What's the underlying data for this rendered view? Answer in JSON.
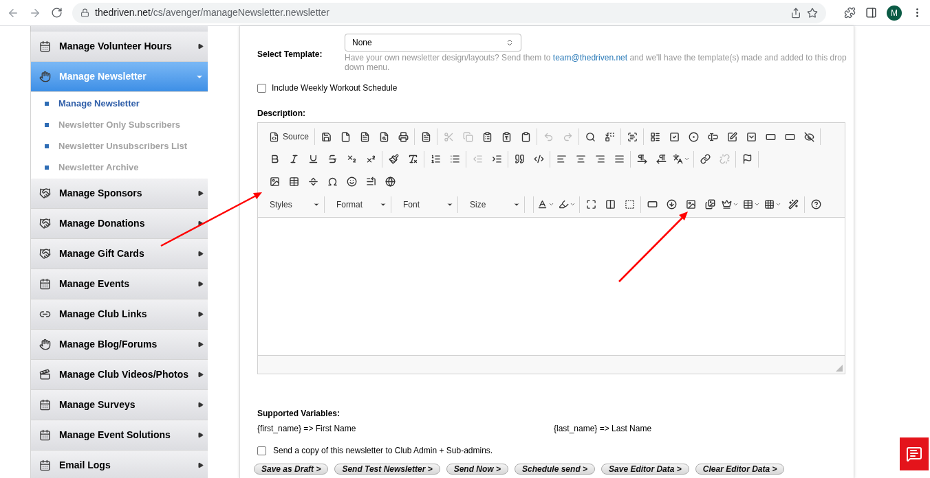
{
  "browser": {
    "url_domain": "thedriven.net",
    "url_path": "/cs/avenger/manageNewsletter.newsletter",
    "avatar": "M"
  },
  "sidebar": {
    "items": [
      {
        "label": "Manage Volunteer Hours",
        "selected": false,
        "expanded": false
      },
      {
        "label": "Manage Newsletter",
        "selected": true,
        "expanded": true,
        "children": [
          {
            "label": "Manage Newsletter",
            "selected": true
          },
          {
            "label": "Newsletter Only Subscribers",
            "selected": false
          },
          {
            "label": "Newsletter Unsubscribers List",
            "selected": false
          },
          {
            "label": "Newsletter Archive",
            "selected": false
          }
        ]
      },
      {
        "label": "Manage Sponsors",
        "selected": false,
        "expanded": false
      },
      {
        "label": "Manage Donations",
        "selected": false,
        "expanded": false
      },
      {
        "label": "Manage Gift Cards",
        "selected": false,
        "expanded": false
      },
      {
        "label": "Manage Events",
        "selected": false,
        "expanded": false
      },
      {
        "label": "Manage Club Links",
        "selected": false,
        "expanded": false
      },
      {
        "label": "Manage Blog/Forums",
        "selected": false,
        "expanded": false
      },
      {
        "label": "Manage Club Videos/Photos",
        "selected": false,
        "expanded": false
      },
      {
        "label": "Manage Surveys",
        "selected": false,
        "expanded": false
      },
      {
        "label": "Manage Event Solutions",
        "selected": false,
        "expanded": false
      },
      {
        "label": "Email Logs",
        "selected": false,
        "expanded": false
      }
    ]
  },
  "form": {
    "template_label": "Select Template:",
    "template_value": "None",
    "template_hint_before": "Have your own newsletter design/layouts? Send them to ",
    "template_hint_link": "team@thedriven.net",
    "template_hint_after": " and we'll have the template(s) made and added to this drop down menu.",
    "weekly_workout": {
      "label": "Include Weekly Workout Schedule",
      "checked": false
    },
    "description_label": "Description:",
    "toolbar": [
      [
        [
          {
            "kind": "labeled",
            "label": "Source",
            "disabled": false
          }
        ],
        [
          {
            "kind": "icon",
            "disabled": false
          },
          {
            "kind": "icon",
            "disabled": false
          },
          {
            "kind": "icon",
            "disabled": false
          },
          {
            "kind": "icon",
            "disabled": false
          },
          {
            "kind": "icon",
            "disabled": false
          }
        ],
        [
          {
            "kind": "icon",
            "disabled": false
          }
        ],
        [
          {
            "kind": "icon",
            "disabled": true
          },
          {
            "kind": "icon",
            "disabled": true
          },
          {
            "kind": "icon",
            "disabled": false
          },
          {
            "kind": "icon",
            "disabled": false
          },
          {
            "kind": "icon",
            "disabled": false
          }
        ],
        [
          {
            "kind": "icon",
            "disabled": true
          },
          {
            "kind": "icon",
            "disabled": true
          }
        ],
        [
          {
            "kind": "icon",
            "disabled": false
          },
          {
            "kind": "icon",
            "disabled": false
          }
        ],
        [
          {
            "kind": "icon",
            "disabled": false
          }
        ],
        [
          {
            "kind": "icon",
            "disabled": false
          },
          {
            "kind": "icon",
            "disabled": false
          },
          {
            "kind": "icon",
            "disabled": false
          },
          {
            "kind": "icon",
            "disabled": false
          },
          {
            "kind": "icon",
            "disabled": false
          },
          {
            "kind": "icon",
            "disabled": false
          },
          {
            "kind": "icon",
            "disabled": false
          },
          {
            "kind": "icon",
            "disabled": false
          },
          {
            "kind": "icon",
            "disabled": false
          }
        ]
      ],
      [
        [
          {
            "kind": "icon",
            "disabled": false
          },
          {
            "kind": "icon",
            "disabled": false
          },
          {
            "kind": "icon",
            "disabled": false
          },
          {
            "kind": "icon",
            "disabled": false
          },
          {
            "kind": "icon",
            "disabled": false
          },
          {
            "kind": "icon",
            "disabled": false
          }
        ],
        [
          {
            "kind": "icon",
            "disabled": false
          },
          {
            "kind": "icon",
            "disabled": false
          }
        ],
        [
          {
            "kind": "icon",
            "disabled": false
          },
          {
            "kind": "icon",
            "disabled": false
          }
        ],
        [
          {
            "kind": "icon",
            "disabled": true
          },
          {
            "kind": "icon",
            "disabled": false
          }
        ],
        [
          {
            "kind": "icon",
            "disabled": false
          },
          {
            "kind": "icon",
            "disabled": false
          }
        ],
        [
          {
            "kind": "icon",
            "disabled": false
          },
          {
            "kind": "icon",
            "disabled": false
          },
          {
            "kind": "icon",
            "disabled": false
          },
          {
            "kind": "icon",
            "disabled": false
          }
        ],
        [
          {
            "kind": "icon",
            "disabled": false
          },
          {
            "kind": "icon",
            "disabled": false
          },
          {
            "kind": "icon",
            "disabled": false
          }
        ],
        [
          {
            "kind": "icon",
            "disabled": false
          },
          {
            "kind": "icon",
            "disabled": true
          }
        ],
        [
          {
            "kind": "icon",
            "disabled": false
          }
        ]
      ],
      [
        [
          {
            "kind": "icon",
            "disabled": false
          },
          {
            "kind": "icon",
            "disabled": false
          },
          {
            "kind": "icon",
            "disabled": false
          },
          {
            "kind": "icon",
            "disabled": false
          },
          {
            "kind": "icon",
            "disabled": false
          },
          {
            "kind": "icon",
            "disabled": false
          },
          {
            "kind": "icon",
            "disabled": false
          }
        ]
      ],
      [
        [
          {
            "kind": "combo",
            "label": "Styles",
            "disabled": false
          },
          {
            "kind": "combo",
            "label": "Format",
            "disabled": false
          },
          {
            "kind": "combo",
            "label": "Font",
            "disabled": false
          },
          {
            "kind": "combo",
            "label": "Size",
            "disabled": false
          }
        ],
        [
          {
            "kind": "icon",
            "disabled": false
          },
          {
            "kind": "icon",
            "disabled": false
          }
        ],
        [
          {
            "kind": "icon",
            "disabled": false
          },
          {
            "kind": "icon",
            "disabled": false
          },
          {
            "kind": "icon",
            "disabled": false
          }
        ],
        [
          {
            "kind": "icon",
            "disabled": false
          },
          {
            "kind": "icon",
            "disabled": false
          },
          {
            "kind": "icon",
            "disabled": false
          },
          {
            "kind": "icon",
            "disabled": false
          },
          {
            "kind": "icon",
            "disabled": false
          },
          {
            "kind": "icon",
            "disabled": false
          },
          {
            "kind": "icon",
            "disabled": false
          },
          {
            "kind": "icon",
            "disabled": false
          }
        ],
        [
          {
            "kind": "icon",
            "disabled": false
          }
        ]
      ]
    ],
    "variables_title": "Supported Variables:",
    "variables": [
      "{first_name} => First Name",
      "{last_name} => Last Name"
    ],
    "send_copy": {
      "label": "Send a copy of this newsletter to Club Admin + Sub-admins.",
      "checked": false
    },
    "buttons": [
      "Save as Draft >",
      "Send Test Newsletter >",
      "Send Now >",
      "Schedule send >",
      "Save Editor Data >",
      "Clear Editor Data >"
    ]
  }
}
